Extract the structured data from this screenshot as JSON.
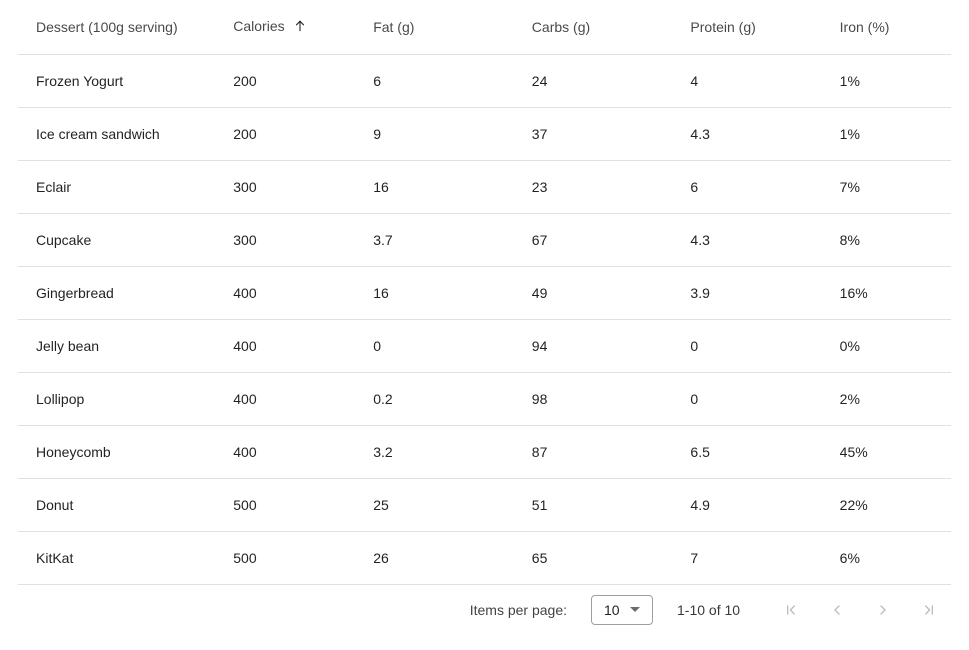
{
  "columns": [
    {
      "label": "Dessert (100g serving)",
      "sorted": false
    },
    {
      "label": "Calories",
      "sorted": true,
      "sort_dir": "asc"
    },
    {
      "label": "Fat (g)",
      "sorted": false
    },
    {
      "label": "Carbs (g)",
      "sorted": false
    },
    {
      "label": "Protein (g)",
      "sorted": false
    },
    {
      "label": "Iron (%)",
      "sorted": false
    }
  ],
  "rows": [
    {
      "dessert": "Frozen Yogurt",
      "calories": "200",
      "fat": "6",
      "carbs": "24",
      "protein": "4",
      "iron": "1%"
    },
    {
      "dessert": "Ice cream sandwich",
      "calories": "200",
      "fat": "9",
      "carbs": "37",
      "protein": "4.3",
      "iron": "1%"
    },
    {
      "dessert": "Eclair",
      "calories": "300",
      "fat": "16",
      "carbs": "23",
      "protein": "6",
      "iron": "7%"
    },
    {
      "dessert": "Cupcake",
      "calories": "300",
      "fat": "3.7",
      "carbs": "67",
      "protein": "4.3",
      "iron": "8%"
    },
    {
      "dessert": "Gingerbread",
      "calories": "400",
      "fat": "16",
      "carbs": "49",
      "protein": "3.9",
      "iron": "16%"
    },
    {
      "dessert": "Jelly bean",
      "calories": "400",
      "fat": "0",
      "carbs": "94",
      "protein": "0",
      "iron": "0%"
    },
    {
      "dessert": "Lollipop",
      "calories": "400",
      "fat": "0.2",
      "carbs": "98",
      "protein": "0",
      "iron": "2%"
    },
    {
      "dessert": "Honeycomb",
      "calories": "400",
      "fat": "3.2",
      "carbs": "87",
      "protein": "6.5",
      "iron": "45%"
    },
    {
      "dessert": "Donut",
      "calories": "500",
      "fat": "25",
      "carbs": "51",
      "protein": "4.9",
      "iron": "22%"
    },
    {
      "dessert": "KitKat",
      "calories": "500",
      "fat": "26",
      "carbs": "65",
      "protein": "7",
      "iron": "6%"
    }
  ],
  "paginator": {
    "items_per_page_label": "Items per page:",
    "page_size": "10",
    "range_label": "1-10 of 10"
  }
}
